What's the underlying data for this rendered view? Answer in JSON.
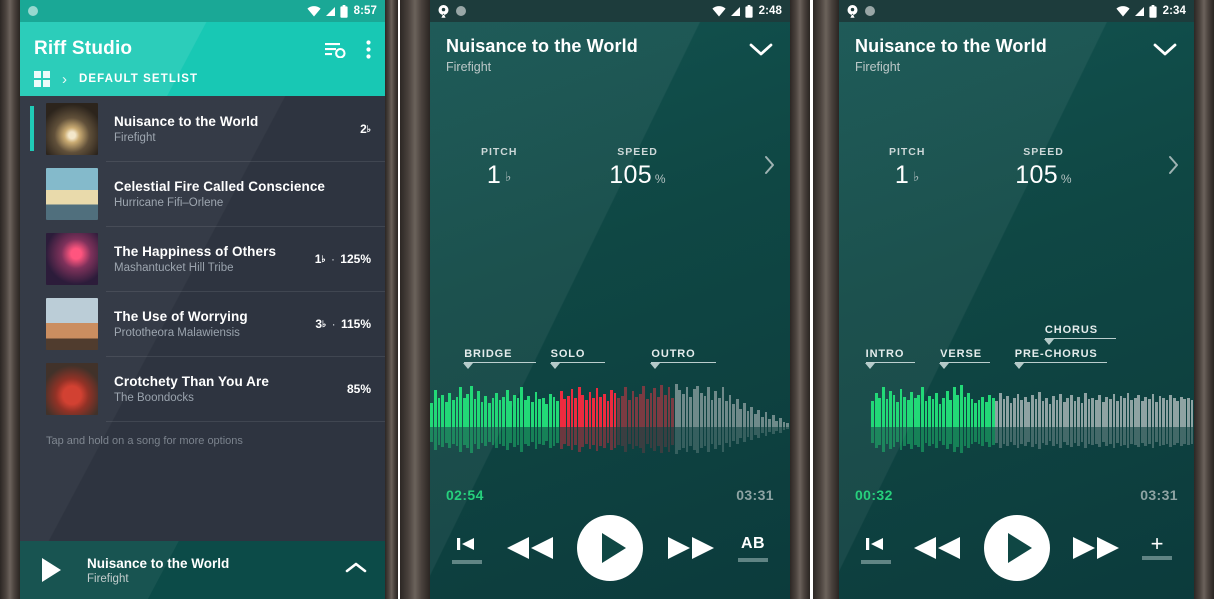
{
  "app": {
    "name": "Riff Studio"
  },
  "panel1": {
    "statusbar": {
      "time": "8:57",
      "icons": [
        "dot-icon",
        "wifi-icon",
        "signal-icon",
        "battery-icon"
      ]
    },
    "appbar": {
      "title": "Riff Studio",
      "sort_icon": "sort-options-icon",
      "overflow_icon": "overflow-menu-icon"
    },
    "breadcrumb": {
      "grid_icon": "grid-view-icon",
      "separator": "›",
      "label": "DEFAULT SETLIST"
    },
    "songs": [
      {
        "title": "Nuisance to the World",
        "artist": "Firefight",
        "pitch": "2",
        "flat": "♭",
        "speed": "",
        "selected": true,
        "art": "tunnel"
      },
      {
        "title": "Celestial Fire Called Conscience",
        "artist": "Hurricane Fifi–Orlene",
        "pitch": "",
        "flat": "",
        "speed": "",
        "selected": false,
        "art": "skate"
      },
      {
        "title": "The Happiness of Others",
        "artist": "Mashantucket Hill Tribe",
        "pitch": "1",
        "flat": "♭",
        "speed": "125%",
        "selected": false,
        "art": "neon"
      },
      {
        "title": "The Use of Worrying",
        "artist": "Prototheora Malawiensis",
        "pitch": "3",
        "flat": "♭",
        "speed": "115%",
        "selected": false,
        "art": "dog"
      },
      {
        "title": "Crotchety Than You Are",
        "artist": "The Boondocks",
        "pitch": "",
        "flat": "",
        "speed": "85%",
        "selected": false,
        "art": "car"
      }
    ],
    "hint": "Tap and hold on a song for more options",
    "nowplaying": {
      "play_icon": "play-icon",
      "title": "Nuisance to the World",
      "artist": "Firefight",
      "expand_icon": "chevron-up-icon"
    }
  },
  "panel2": {
    "statusbar": {
      "time": "2:48",
      "icons": [
        "location-icon",
        "dot-icon",
        "wifi-icon",
        "signal-icon",
        "battery-icon"
      ]
    },
    "header": {
      "title": "Nuisance to the World",
      "artist": "Firefight",
      "collapse_icon": "chevron-down-icon"
    },
    "controls": {
      "pitch_label": "PITCH",
      "pitch_value": "1",
      "pitch_unit": "♭",
      "speed_label": "SPEED",
      "speed_value": "105",
      "speed_unit": "%",
      "next_icon": "chevron-right-icon"
    },
    "sections": [
      {
        "label": "BRIDGE",
        "left_pct": 9.5,
        "width_pct": 20,
        "row": 0
      },
      {
        "label": "SOLO",
        "left_pct": 33.5,
        "width_pct": 15,
        "row": 0
      },
      {
        "label": "OUTRO",
        "left_pct": 61.5,
        "width_pct": 18,
        "row": 0
      }
    ],
    "times": {
      "current": "02:54",
      "total": "03:31"
    },
    "colors": {
      "played": "#22d977",
      "active": "#ec2b3f",
      "upcoming": "#6f8a8a",
      "dim_red": "#7a3b42"
    },
    "transport": [
      {
        "name": "skip-to-start-button",
        "icon": "skip-previous-icon",
        "underbar": true
      },
      {
        "name": "rewind-button",
        "icon": "rewind-icon",
        "underbar": false
      },
      {
        "name": "play-button",
        "icon": "play-icon",
        "underbar": false
      },
      {
        "name": "fast-forward-button",
        "icon": "fast-forward-icon",
        "underbar": false
      },
      {
        "name": "ab-loop-button",
        "icon": "ab-loop-icon",
        "label": "AB",
        "underbar": true
      }
    ],
    "waveform": {
      "played_end_pct": 36,
      "active_end_pct": 52,
      "dim_end_pct": 68,
      "amps": [
        0.52,
        0.8,
        0.62,
        0.7,
        0.55,
        0.75,
        0.58,
        0.66,
        0.86,
        0.64,
        0.72,
        0.9,
        0.6,
        0.78,
        0.55,
        0.68,
        0.52,
        0.62,
        0.74,
        0.58,
        0.66,
        0.8,
        0.56,
        0.7,
        0.63,
        0.86,
        0.58,
        0.68,
        0.54,
        0.76,
        0.6,
        0.64,
        0.5,
        0.72,
        0.66,
        0.56,
        0.78,
        0.6,
        0.68,
        0.82,
        0.64,
        0.88,
        0.7,
        0.58,
        0.76,
        0.62,
        0.84,
        0.66,
        0.72,
        0.56,
        0.8,
        0.74,
        0.62,
        0.68,
        0.86,
        0.58,
        0.78,
        0.66,
        0.72,
        0.9,
        0.6,
        0.74,
        0.84,
        0.66,
        0.92,
        0.7,
        0.86,
        0.62,
        0.94,
        0.8,
        0.72,
        0.88,
        0.66,
        0.82,
        0.9,
        0.74,
        0.68,
        0.86,
        0.58,
        0.78,
        0.64,
        0.88,
        0.56,
        0.7,
        0.5,
        0.6,
        0.4,
        0.52,
        0.34,
        0.44,
        0.28,
        0.38,
        0.22,
        0.32,
        0.18,
        0.26,
        0.14,
        0.2,
        0.1,
        0.08
      ]
    }
  },
  "panel3": {
    "statusbar": {
      "time": "2:34",
      "icons": [
        "location-icon",
        "dot-icon",
        "wifi-icon",
        "signal-icon",
        "battery-icon"
      ]
    },
    "header": {
      "title": "Nuisance to the World",
      "artist": "Firefight",
      "collapse_icon": "chevron-down-icon"
    },
    "controls": {
      "pitch_label": "PITCH",
      "pitch_value": "1",
      "pitch_unit": "♭",
      "speed_label": "SPEED",
      "speed_value": "105",
      "speed_unit": "%",
      "next_icon": "chevron-right-icon"
    },
    "sections": [
      {
        "label": "INTRO",
        "left_pct": 7.5,
        "width_pct": 14,
        "row": 0
      },
      {
        "label": "VERSE",
        "left_pct": 28.5,
        "width_pct": 14,
        "row": 0
      },
      {
        "label": "PRE-CHORUS",
        "left_pct": 49.5,
        "width_pct": 26,
        "row": 0
      },
      {
        "label": "CHORUS",
        "left_pct": 58.0,
        "width_pct": 20,
        "row": 1
      }
    ],
    "times": {
      "current": "00:32",
      "total": "03:31"
    },
    "colors": {
      "played": "#22d977",
      "upcoming": "#8fa3a3"
    },
    "transport": [
      {
        "name": "skip-to-start-button",
        "icon": "skip-previous-icon",
        "underbar": true
      },
      {
        "name": "rewind-button",
        "icon": "rewind-icon",
        "underbar": false
      },
      {
        "name": "play-button",
        "icon": "play-icon",
        "underbar": false
      },
      {
        "name": "fast-forward-button",
        "icon": "fast-forward-icon",
        "underbar": false
      },
      {
        "name": "add-section-button",
        "icon": "plus-icon",
        "label": "+",
        "underbar": true
      }
    ],
    "waveform": {
      "start_pct": 9,
      "played_end_pct": 44,
      "amps": [
        0.28,
        0.55,
        0.72,
        0.84,
        0.62,
        0.76,
        0.58,
        0.68,
        0.8,
        0.56,
        0.74,
        0.64,
        0.88,
        0.6,
        0.78,
        0.7,
        0.54,
        0.82,
        0.66,
        0.58,
        0.76,
        0.62,
        0.7,
        0.86,
        0.56,
        0.68,
        0.6,
        0.74,
        0.5,
        0.64,
        0.78,
        0.58,
        0.86,
        0.7,
        0.92,
        0.66,
        0.74,
        0.6,
        0.52,
        0.58,
        0.66,
        0.54,
        0.7,
        0.62,
        0.56,
        0.74,
        0.6,
        0.68,
        0.52,
        0.64,
        0.72,
        0.58,
        0.66,
        0.54,
        0.7,
        0.6,
        0.76,
        0.56,
        0.64,
        0.5,
        0.68,
        0.58,
        0.72,
        0.54,
        0.62,
        0.7,
        0.56,
        0.66,
        0.52,
        0.74,
        0.6,
        0.64,
        0.58,
        0.7,
        0.54,
        0.66,
        0.6,
        0.72,
        0.56,
        0.68,
        0.62,
        0.74,
        0.58,
        0.64,
        0.7,
        0.56,
        0.66,
        0.6,
        0.72,
        0.54,
        0.68,
        0.62,
        0.58,
        0.7,
        0.64,
        0.56,
        0.66,
        0.6,
        0.62,
        0.58
      ]
    }
  }
}
